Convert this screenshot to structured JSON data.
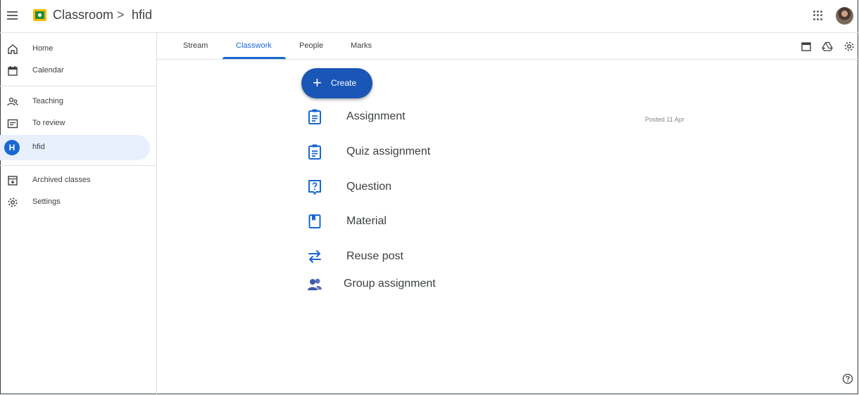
{
  "header": {
    "app_title": "Classroom",
    "breadcrumb_separator": ">",
    "class_name": "hfid"
  },
  "sidebar": {
    "items": [
      {
        "label": "Home",
        "icon": "home-icon"
      },
      {
        "label": "Calendar",
        "icon": "calendar-icon"
      },
      {
        "label": "Teaching",
        "icon": "people-icon"
      },
      {
        "label": "To review",
        "icon": "inbox-icon"
      },
      {
        "label": "hfid",
        "icon": "class-avatar",
        "avatar_letter": "H",
        "active": true
      },
      {
        "label": "Archived classes",
        "icon": "archive-icon"
      },
      {
        "label": "Settings",
        "icon": "gear-icon"
      }
    ]
  },
  "tabs": [
    {
      "label": "Stream"
    },
    {
      "label": "Classwork",
      "active": true
    },
    {
      "label": "People"
    },
    {
      "label": "Marks"
    }
  ],
  "create": {
    "label": "Create",
    "menu": [
      {
        "label": "Assignment",
        "icon": "assignment-icon"
      },
      {
        "label": "Quiz assignment",
        "icon": "quiz-icon"
      },
      {
        "label": "Question",
        "icon": "question-icon"
      },
      {
        "label": "Material",
        "icon": "material-icon"
      },
      {
        "label": "Reuse post",
        "icon": "reuse-icon"
      },
      {
        "label": "Group assignment",
        "icon": "group-icon"
      }
    ]
  },
  "posted_text": "Posted 11 Apr",
  "colors": {
    "accent": "#1967d2",
    "create_button": "#1a56b5",
    "active_nav": "#e8f0fe"
  }
}
